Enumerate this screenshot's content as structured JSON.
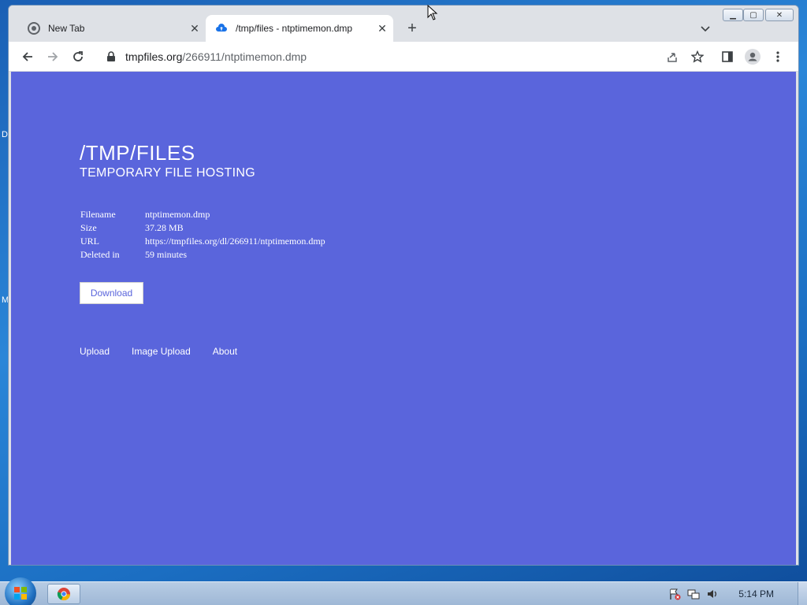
{
  "browser": {
    "tabs": [
      {
        "title": "New Tab",
        "favicon": "chrome-icon",
        "active": false
      },
      {
        "title": "/tmp/files - ntptimemon.dmp",
        "favicon": "cloud-upload-icon",
        "active": true
      }
    ],
    "address": {
      "host": "tmpfiles.org",
      "path": "/266911/ntptimemon.dmp"
    }
  },
  "page": {
    "title": "/TMP/FILES",
    "subtitle": "TEMPORARY FILE HOSTING",
    "info": [
      {
        "label": "Filename",
        "value": "ntptimemon.dmp"
      },
      {
        "label": "Size",
        "value": "37.28 MB"
      },
      {
        "label": "URL",
        "value": "https://tmpfiles.org/dl/266911/ntptimemon.dmp"
      },
      {
        "label": "Deleted in",
        "value": "59 minutes"
      }
    ],
    "download_label": "Download",
    "nav": [
      "Upload",
      "Image Upload",
      "About"
    ],
    "background_color": "#5a65dc"
  },
  "desktop": {
    "edge_letters": [
      "D",
      "M"
    ]
  },
  "taskbar": {
    "clock": "5:14 PM",
    "pinned_app": "chrome-icon"
  }
}
